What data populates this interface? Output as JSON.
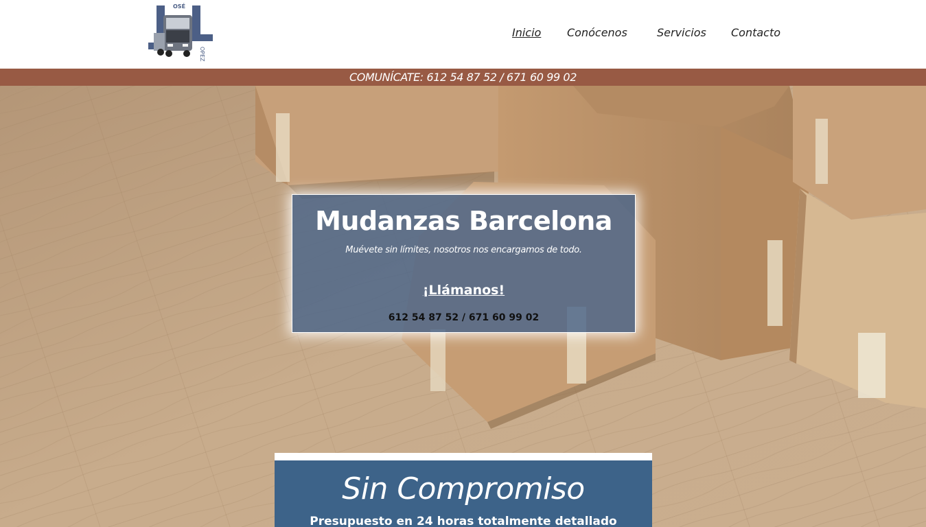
{
  "logo": {
    "letters": [
      "J",
      "L"
    ],
    "top_text": "OSÉ",
    "side_text": "OPEZ"
  },
  "nav": {
    "items": [
      {
        "label": "Inicio",
        "active": true
      },
      {
        "label": "Conócenos",
        "active": false
      },
      {
        "label": "Servicios",
        "active": false
      },
      {
        "label": "Contacto",
        "active": false
      }
    ]
  },
  "contact_strip": {
    "text": "COMUNÍCATE: 612 54 87 52 / 671 60 99 02"
  },
  "hero": {
    "title": "Mudanzas Barcelona",
    "subtitle": "Muévete sin límites, nosotros nos encargamos de todo.",
    "cta": "¡Llámanos!",
    "phones": "612 54 87 52 / 671 60 99 02"
  },
  "promo": {
    "title": "Sin Compromiso",
    "subtitle": "Presupuesto en 24 horas totalmente detallado"
  },
  "colors": {
    "strip": "#985a44",
    "hero_card": "#4a658a",
    "promo_card": "#3d6389",
    "logo_blue": "#4c5f86"
  }
}
